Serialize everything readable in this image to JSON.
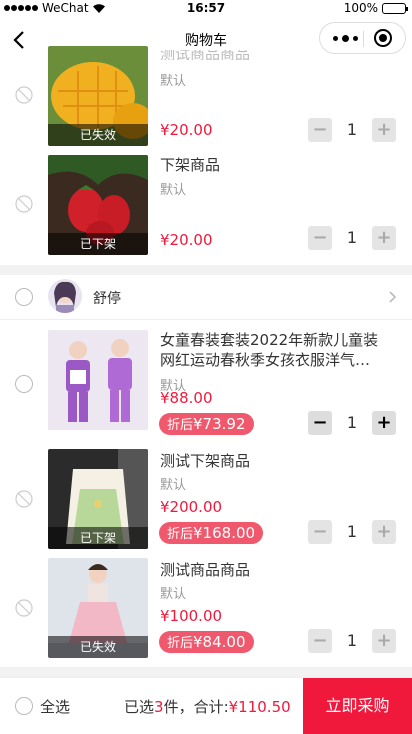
{
  "status_bar": {
    "carrier": "WeChat",
    "time": "16:57",
    "battery": "100%"
  },
  "nav": {
    "title": "购物车"
  },
  "items": [
    {
      "name": "测试商品商品",
      "spec": "默认",
      "price": "¥20.00",
      "overlay": "已失效",
      "qty": "1"
    },
    {
      "name": "下架商品",
      "spec": "默认",
      "price": "¥20.00",
      "overlay": "已下架",
      "qty": "1"
    }
  ],
  "store": {
    "name": "舒停"
  },
  "store_items": [
    {
      "name": "女童春装套装2022年新款儿童装网红运动春秋季女孩衣服洋气…",
      "spec": "默认",
      "price": "¥88.00",
      "discount_prefix": "折后",
      "discount": "¥73.92",
      "qty": "1"
    },
    {
      "name": "测试下架商品",
      "spec": "默认",
      "price": "¥200.00",
      "discount_prefix": "折后",
      "discount": "¥168.00",
      "overlay": "已下架",
      "qty": "1"
    },
    {
      "name": "测试商品商品",
      "spec": "默认",
      "price": "¥100.00",
      "discount_prefix": "折后",
      "discount": "¥84.00",
      "overlay": "已失效",
      "qty": "1"
    }
  ],
  "stepper": {
    "minus": "−",
    "plus": "+"
  },
  "bottom": {
    "select_all": "全选",
    "selected_prefix": "已选",
    "selected_count": "3",
    "selected_suffix": "件，合计:",
    "total": "¥110.50",
    "buy_button": "立即采购"
  },
  "colors": {
    "accent": "#f0193c",
    "discount_pill": "#f0596d"
  },
  "icons": [
    "back-icon",
    "more-icon",
    "target-icon",
    "disabled-circle-icon",
    "chevron-right-icon"
  ]
}
